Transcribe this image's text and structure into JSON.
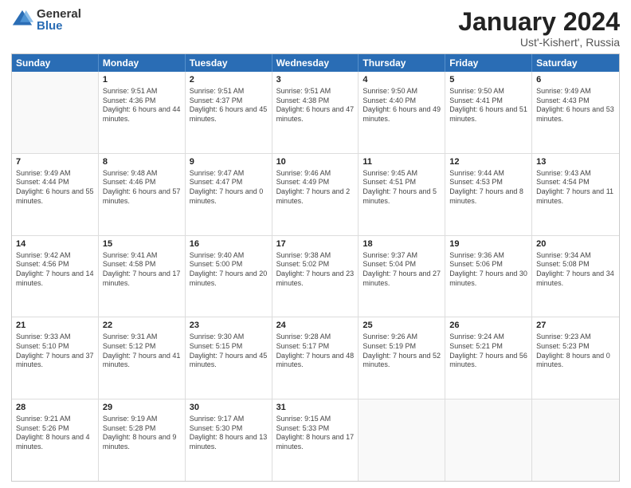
{
  "logo": {
    "general": "General",
    "blue": "Blue"
  },
  "title": {
    "month": "January 2024",
    "location": "Ust'-Kishert', Russia"
  },
  "weekdays": [
    "Sunday",
    "Monday",
    "Tuesday",
    "Wednesday",
    "Thursday",
    "Friday",
    "Saturday"
  ],
  "weeks": [
    [
      {
        "day": "",
        "sunrise": "",
        "sunset": "",
        "daylight": ""
      },
      {
        "day": "1",
        "sunrise": "Sunrise: 9:51 AM",
        "sunset": "Sunset: 4:36 PM",
        "daylight": "Daylight: 6 hours and 44 minutes."
      },
      {
        "day": "2",
        "sunrise": "Sunrise: 9:51 AM",
        "sunset": "Sunset: 4:37 PM",
        "daylight": "Daylight: 6 hours and 45 minutes."
      },
      {
        "day": "3",
        "sunrise": "Sunrise: 9:51 AM",
        "sunset": "Sunset: 4:38 PM",
        "daylight": "Daylight: 6 hours and 47 minutes."
      },
      {
        "day": "4",
        "sunrise": "Sunrise: 9:50 AM",
        "sunset": "Sunset: 4:40 PM",
        "daylight": "Daylight: 6 hours and 49 minutes."
      },
      {
        "day": "5",
        "sunrise": "Sunrise: 9:50 AM",
        "sunset": "Sunset: 4:41 PM",
        "daylight": "Daylight: 6 hours and 51 minutes."
      },
      {
        "day": "6",
        "sunrise": "Sunrise: 9:49 AM",
        "sunset": "Sunset: 4:43 PM",
        "daylight": "Daylight: 6 hours and 53 minutes."
      }
    ],
    [
      {
        "day": "7",
        "sunrise": "Sunrise: 9:49 AM",
        "sunset": "Sunset: 4:44 PM",
        "daylight": "Daylight: 6 hours and 55 minutes."
      },
      {
        "day": "8",
        "sunrise": "Sunrise: 9:48 AM",
        "sunset": "Sunset: 4:46 PM",
        "daylight": "Daylight: 6 hours and 57 minutes."
      },
      {
        "day": "9",
        "sunrise": "Sunrise: 9:47 AM",
        "sunset": "Sunset: 4:47 PM",
        "daylight": "Daylight: 7 hours and 0 minutes."
      },
      {
        "day": "10",
        "sunrise": "Sunrise: 9:46 AM",
        "sunset": "Sunset: 4:49 PM",
        "daylight": "Daylight: 7 hours and 2 minutes."
      },
      {
        "day": "11",
        "sunrise": "Sunrise: 9:45 AM",
        "sunset": "Sunset: 4:51 PM",
        "daylight": "Daylight: 7 hours and 5 minutes."
      },
      {
        "day": "12",
        "sunrise": "Sunrise: 9:44 AM",
        "sunset": "Sunset: 4:53 PM",
        "daylight": "Daylight: 7 hours and 8 minutes."
      },
      {
        "day": "13",
        "sunrise": "Sunrise: 9:43 AM",
        "sunset": "Sunset: 4:54 PM",
        "daylight": "Daylight: 7 hours and 11 minutes."
      }
    ],
    [
      {
        "day": "14",
        "sunrise": "Sunrise: 9:42 AM",
        "sunset": "Sunset: 4:56 PM",
        "daylight": "Daylight: 7 hours and 14 minutes."
      },
      {
        "day": "15",
        "sunrise": "Sunrise: 9:41 AM",
        "sunset": "Sunset: 4:58 PM",
        "daylight": "Daylight: 7 hours and 17 minutes."
      },
      {
        "day": "16",
        "sunrise": "Sunrise: 9:40 AM",
        "sunset": "Sunset: 5:00 PM",
        "daylight": "Daylight: 7 hours and 20 minutes."
      },
      {
        "day": "17",
        "sunrise": "Sunrise: 9:38 AM",
        "sunset": "Sunset: 5:02 PM",
        "daylight": "Daylight: 7 hours and 23 minutes."
      },
      {
        "day": "18",
        "sunrise": "Sunrise: 9:37 AM",
        "sunset": "Sunset: 5:04 PM",
        "daylight": "Daylight: 7 hours and 27 minutes."
      },
      {
        "day": "19",
        "sunrise": "Sunrise: 9:36 AM",
        "sunset": "Sunset: 5:06 PM",
        "daylight": "Daylight: 7 hours and 30 minutes."
      },
      {
        "day": "20",
        "sunrise": "Sunrise: 9:34 AM",
        "sunset": "Sunset: 5:08 PM",
        "daylight": "Daylight: 7 hours and 34 minutes."
      }
    ],
    [
      {
        "day": "21",
        "sunrise": "Sunrise: 9:33 AM",
        "sunset": "Sunset: 5:10 PM",
        "daylight": "Daylight: 7 hours and 37 minutes."
      },
      {
        "day": "22",
        "sunrise": "Sunrise: 9:31 AM",
        "sunset": "Sunset: 5:12 PM",
        "daylight": "Daylight: 7 hours and 41 minutes."
      },
      {
        "day": "23",
        "sunrise": "Sunrise: 9:30 AM",
        "sunset": "Sunset: 5:15 PM",
        "daylight": "Daylight: 7 hours and 45 minutes."
      },
      {
        "day": "24",
        "sunrise": "Sunrise: 9:28 AM",
        "sunset": "Sunset: 5:17 PM",
        "daylight": "Daylight: 7 hours and 48 minutes."
      },
      {
        "day": "25",
        "sunrise": "Sunrise: 9:26 AM",
        "sunset": "Sunset: 5:19 PM",
        "daylight": "Daylight: 7 hours and 52 minutes."
      },
      {
        "day": "26",
        "sunrise": "Sunrise: 9:24 AM",
        "sunset": "Sunset: 5:21 PM",
        "daylight": "Daylight: 7 hours and 56 minutes."
      },
      {
        "day": "27",
        "sunrise": "Sunrise: 9:23 AM",
        "sunset": "Sunset: 5:23 PM",
        "daylight": "Daylight: 8 hours and 0 minutes."
      }
    ],
    [
      {
        "day": "28",
        "sunrise": "Sunrise: 9:21 AM",
        "sunset": "Sunset: 5:26 PM",
        "daylight": "Daylight: 8 hours and 4 minutes."
      },
      {
        "day": "29",
        "sunrise": "Sunrise: 9:19 AM",
        "sunset": "Sunset: 5:28 PM",
        "daylight": "Daylight: 8 hours and 9 minutes."
      },
      {
        "day": "30",
        "sunrise": "Sunrise: 9:17 AM",
        "sunset": "Sunset: 5:30 PM",
        "daylight": "Daylight: 8 hours and 13 minutes."
      },
      {
        "day": "31",
        "sunrise": "Sunrise: 9:15 AM",
        "sunset": "Sunset: 5:33 PM",
        "daylight": "Daylight: 8 hours and 17 minutes."
      },
      {
        "day": "",
        "sunrise": "",
        "sunset": "",
        "daylight": ""
      },
      {
        "day": "",
        "sunrise": "",
        "sunset": "",
        "daylight": ""
      },
      {
        "day": "",
        "sunrise": "",
        "sunset": "",
        "daylight": ""
      }
    ]
  ]
}
